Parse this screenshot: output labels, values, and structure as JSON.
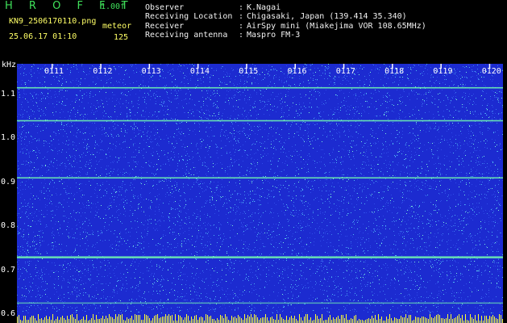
{
  "header": {
    "app_title": "H R O F F T",
    "app_version": "1.00f",
    "file_name": "KN9_2506170110.png",
    "mode_label": "meteor",
    "timestamp": "25.06.17 01:10",
    "count_value": "125"
  },
  "metadata": [
    {
      "label": "Observer",
      "value": "K.Nagai"
    },
    {
      "label": "Receiving Location",
      "value": "Chigasaki, Japan (139.414 35.340)"
    },
    {
      "label": "Receiver",
      "value": "AirSpy mini (Miakejima VOR 108.65MHz)"
    },
    {
      "label": "Receiving antenna",
      "value": "Maspro FM-3"
    }
  ],
  "separator": ":",
  "spectrogram": {
    "y_unit": "kHz",
    "y_ticks": [
      "1.1",
      "1.0",
      "0.9",
      "0.8",
      "0.7",
      "0.6"
    ],
    "y_tick_values": [
      1.1,
      1.0,
      0.9,
      0.8,
      0.7,
      0.6
    ],
    "y_range": [
      0.58,
      1.17
    ],
    "x_ticks": [
      "0111",
      "0112",
      "0113",
      "0114",
      "0115",
      "0116",
      "0117",
      "0118",
      "0119",
      "0120"
    ],
    "background_color": "#1c2bd0",
    "line_color": "#6ff2b0",
    "level_bar_color": "#ffff33",
    "carrier_lines_khz": [
      1.115,
      1.04,
      0.91,
      0.73,
      0.625
    ]
  }
}
